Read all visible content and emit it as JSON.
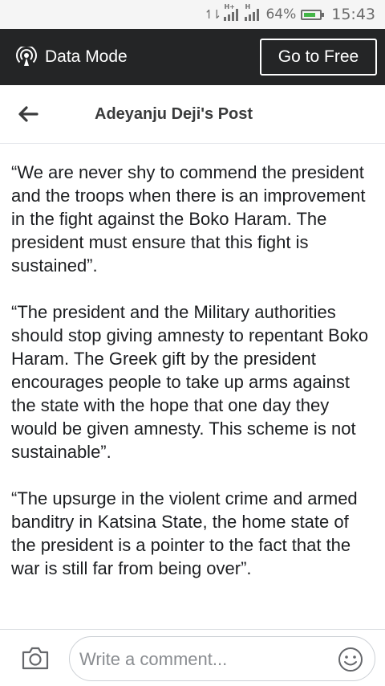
{
  "status_bar": {
    "battery": "64%",
    "time": "15:43"
  },
  "data_bar": {
    "mode_label": "Data Mode",
    "go_free_label": "Go to Free"
  },
  "header": {
    "title": "Adeyanju Deji's Post"
  },
  "post": {
    "paragraphs": [
      "“We are never shy to commend the president and the troops when there is an improvement in the fight against the Boko Haram. The president must ensure that this fight is sustained”.",
      "“The president and the Military authorities should stop giving amnesty to repentant Boko Haram. The Greek gift by the president encourages people to take up arms against the state with the hope that one day they would be given amnesty. This scheme is not sustainable”.",
      "“The upsurge in the violent crime and armed banditry in Katsina State, the home state of the president is a pointer to the fact that the war is still far from being over”."
    ]
  },
  "comment_bar": {
    "placeholder": "Write a comment..."
  },
  "colors": {
    "data_bar_bg": "#242526",
    "battery_fill": "#44b548",
    "title_text": "#3a3b3c"
  },
  "icons": [
    "data-arrows-icon",
    "signal-icon",
    "battery-icon",
    "data-mode-icon",
    "back-arrow-icon",
    "camera-icon",
    "smiley-icon"
  ]
}
